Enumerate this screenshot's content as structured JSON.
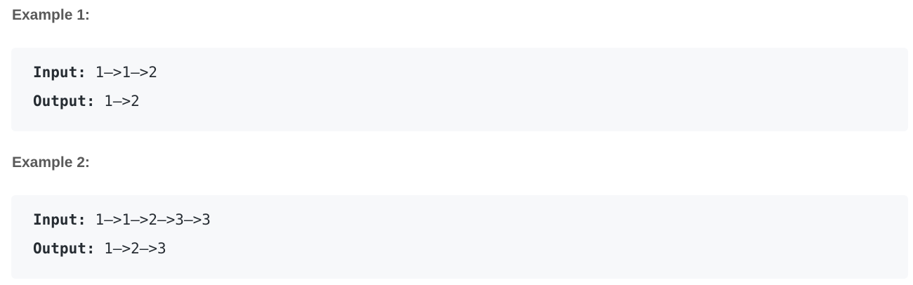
{
  "examples": [
    {
      "title": "Example 1:",
      "input_label": "Input:",
      "input": "1–>1–>2",
      "output_label": "Output:",
      "output": "1–>2"
    },
    {
      "title": "Example 2:",
      "input_label": "Input:",
      "input": "1–>1–>2–>3–>3",
      "output_label": "Output:",
      "output": "1–>2–>3"
    }
  ]
}
